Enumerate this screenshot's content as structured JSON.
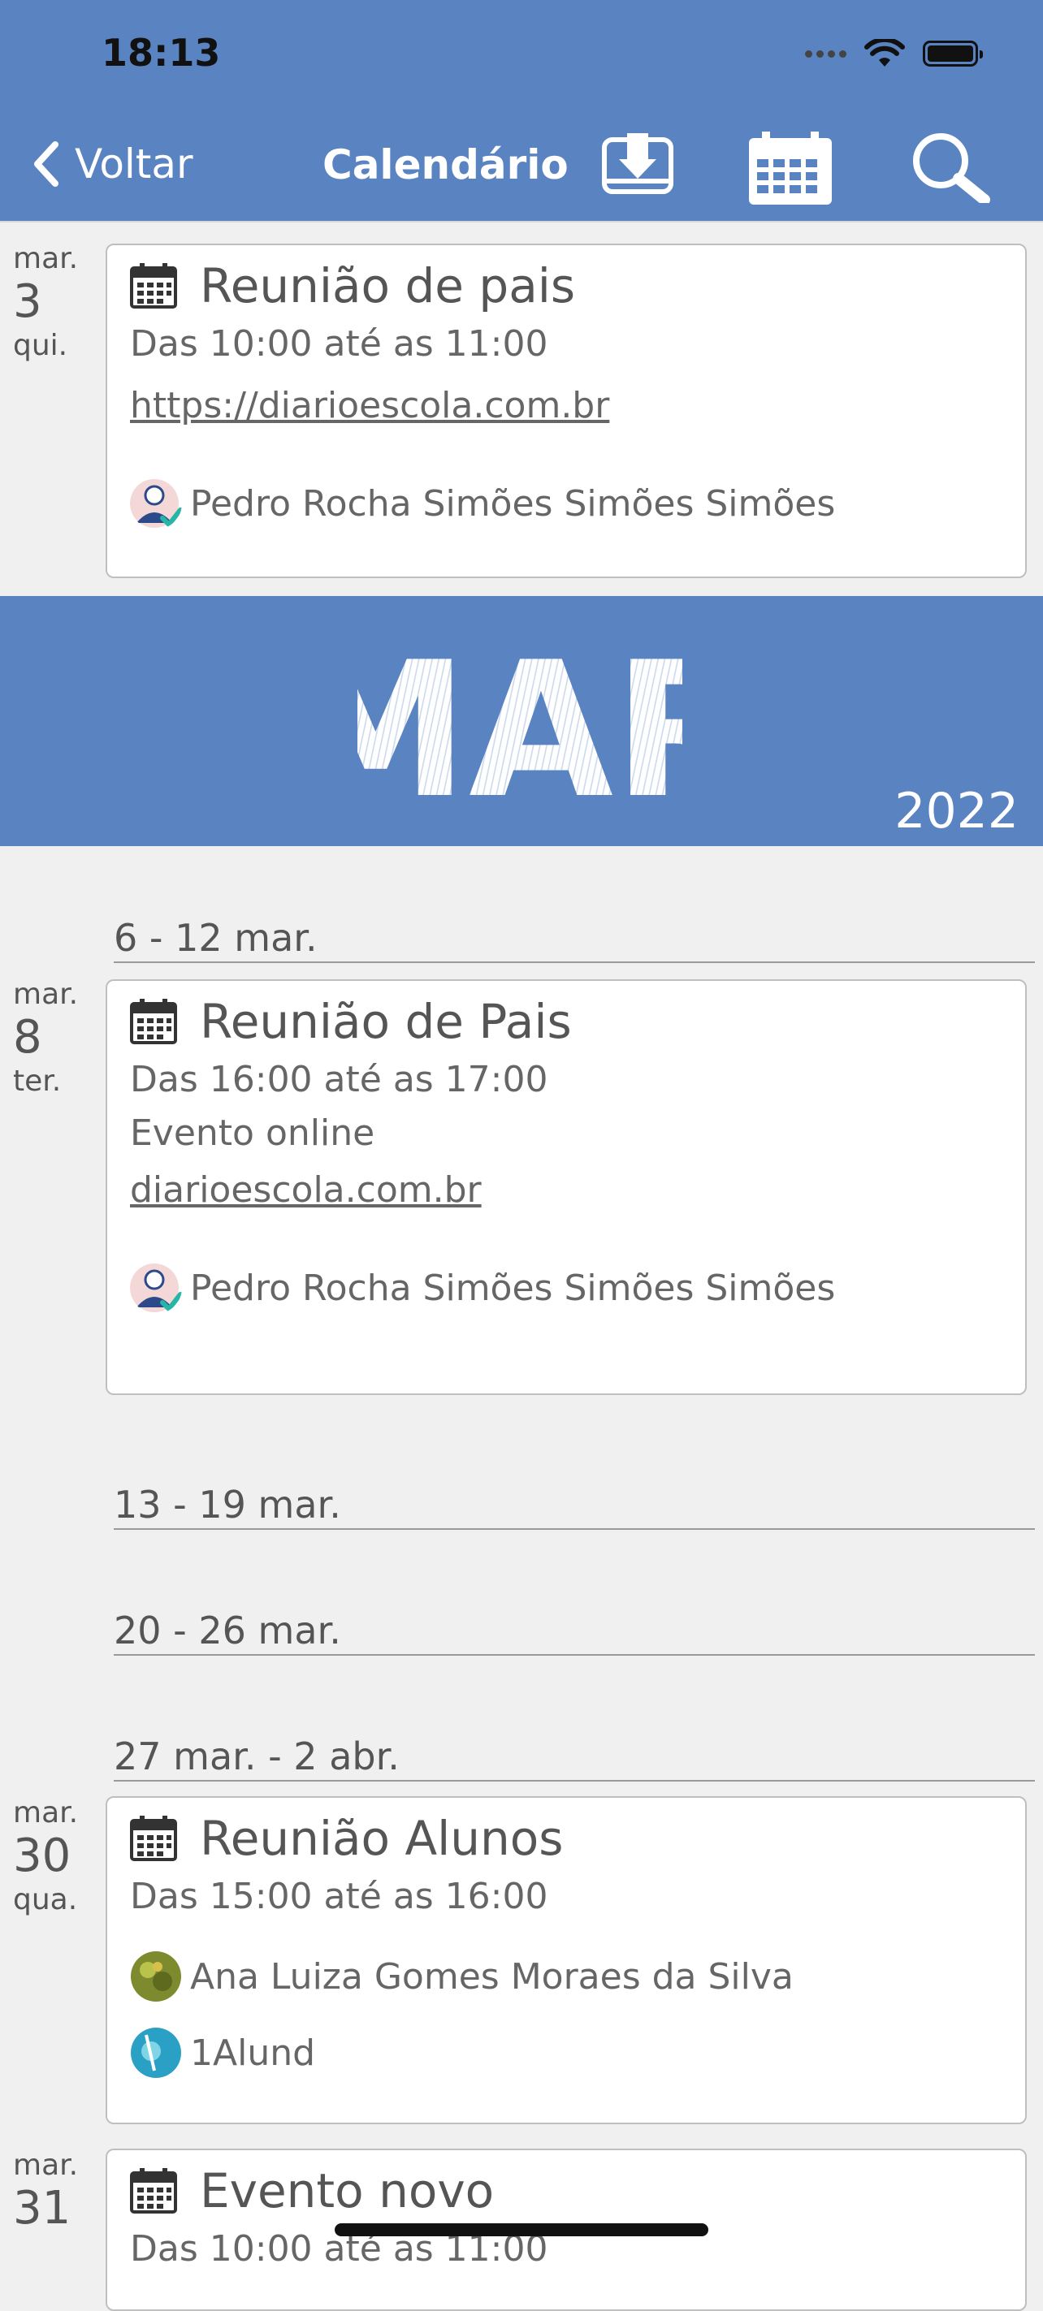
{
  "status_bar": {
    "time": "18:13"
  },
  "header": {
    "back_label": "Voltar",
    "title": "Calendário"
  },
  "banner": {
    "month": "MAR",
    "year": "2022"
  },
  "weeks": [
    "6 - 12 mar.",
    "13 - 19 mar.",
    "20 - 26 mar.",
    "27 mar. - 2 abr."
  ],
  "events": [
    {
      "month": "mar.",
      "day": "3",
      "weekday": "qui.",
      "title": "Reunião de pais",
      "time": "Das 10:00 até as 11:00",
      "link": "https://diarioescola.com.br",
      "people": [
        "Pedro Rocha Simões Simões Simões"
      ]
    },
    {
      "month": "mar.",
      "day": "8",
      "weekday": "ter.",
      "title": "Reunião de Pais",
      "time": "Das 16:00 até as 17:00",
      "location": "Evento online",
      "link": "diarioescola.com.br",
      "people": [
        "Pedro Rocha Simões Simões Simões"
      ]
    },
    {
      "month": "mar.",
      "day": "30",
      "weekday": "qua.",
      "title": "Reunião Alunos",
      "time": "Das 15:00 até as 16:00",
      "people": [
        "Ana Luiza Gomes Moraes da Silva",
        "1Alund"
      ]
    },
    {
      "month": "mar.",
      "day": "31",
      "title": "Evento novo",
      "time": "Das 10:00 até as 11:00"
    }
  ]
}
